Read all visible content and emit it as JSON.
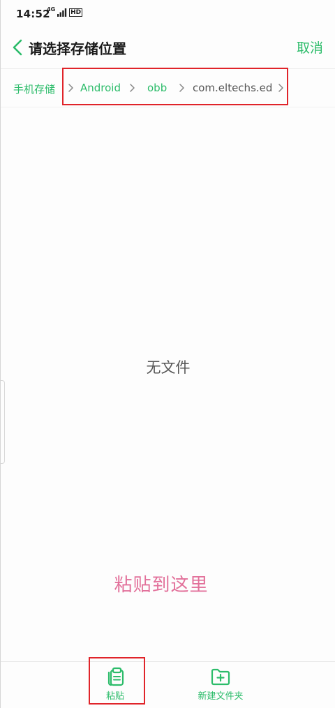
{
  "status_bar": {
    "time": "14:52",
    "net_small": "4G",
    "signal_icon": "signal-bars-icon",
    "hd_badge": "HD"
  },
  "header": {
    "title": "请选择存储位置",
    "cancel_label": "取消",
    "back_icon": "chevron-left-icon"
  },
  "breadcrumb": {
    "items": [
      {
        "label": "手机存储"
      },
      {
        "label": "Android"
      },
      {
        "label": "obb"
      },
      {
        "label": "com.eltechs.ed"
      }
    ],
    "separator_icon": "chevron-right-icon"
  },
  "main": {
    "empty_text": "无文件",
    "paste_hint": "粘贴到这里"
  },
  "bottom_bar": {
    "paste_label": "粘贴",
    "new_folder_label": "新建文件夹",
    "paste_icon": "clipboard-icon",
    "new_folder_icon": "folder-plus-icon"
  },
  "colors": {
    "accent": "#2cbc6a",
    "paste_hint": "#e2709a",
    "highlight": "#e0242a"
  }
}
